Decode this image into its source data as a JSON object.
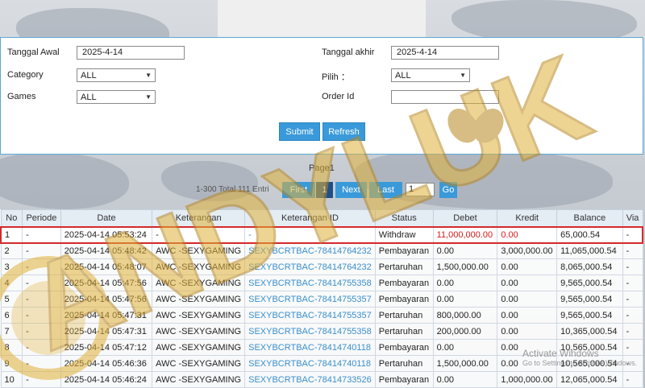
{
  "filters": {
    "tanggal_awal_label": "Tanggal Awal",
    "tanggal_awal_value": "2025-4-14",
    "tanggal_akhir_label": "Tanggal akhir",
    "tanggal_akhir_value": "2025-4-14",
    "category_label": "Category",
    "category_value": "ALL",
    "pilih_label": "Pilih ：",
    "pilih_value": "ALL",
    "games_label": "Games",
    "games_value": "ALL",
    "order_id_label": "Order Id",
    "order_id_value": ""
  },
  "buttons": {
    "submit": "Submit",
    "refresh": "Refresh"
  },
  "pager": {
    "title": "Page1",
    "info": "1-300 Total 111 Entri",
    "first": "First",
    "current": "1",
    "next": "Next",
    "last": "Last",
    "goto_value": "1",
    "go": "Go"
  },
  "table": {
    "headers": [
      "No",
      "Periode",
      "Date",
      "Keterangan",
      "Keterangan ID",
      "Status",
      "Debet",
      "Kredit",
      "Balance",
      "Via"
    ],
    "rows": [
      [
        "1",
        "-",
        "2025-04-14 05:53:24",
        "-",
        "-",
        "Withdraw",
        "11,000,000.00",
        "0.00",
        "65,000.54",
        "-"
      ],
      [
        "2",
        "-",
        "2025-04-14 05:48:42",
        "AWC -SEXYGAMING",
        "SEXYBCRTBAC-78414764232",
        "Pembayaran",
        "0.00",
        "3,000,000.00",
        "11,065,000.54",
        "-"
      ],
      [
        "3",
        "-",
        "2025-04-14 05:48:07",
        "AWC -SEXYGAMING",
        "SEXYBCRTBAC-78414764232",
        "Pertaruhan",
        "1,500,000.00",
        "0.00",
        "8,065,000.54",
        "-"
      ],
      [
        "4",
        "-",
        "2025-04-14 05:47:56",
        "AWC -SEXYGAMING",
        "SEXYBCRTBAC-78414755358",
        "Pembayaran",
        "0.00",
        "0.00",
        "9,565,000.54",
        "-"
      ],
      [
        "5",
        "-",
        "2025-04-14 05:47:56",
        "AWC -SEXYGAMING",
        "SEXYBCRTBAC-78414755357",
        "Pembayaran",
        "0.00",
        "0.00",
        "9,565,000.54",
        "-"
      ],
      [
        "6",
        "-",
        "2025-04-14 05:47:31",
        "AWC -SEXYGAMING",
        "SEXYBCRTBAC-78414755357",
        "Pertaruhan",
        "800,000.00",
        "0.00",
        "9,565,000.54",
        "-"
      ],
      [
        "7",
        "-",
        "2025-04-14 05:47:31",
        "AWC -SEXYGAMING",
        "SEXYBCRTBAC-78414755358",
        "Pertaruhan",
        "200,000.00",
        "0.00",
        "10,365,000.54",
        "-"
      ],
      [
        "8",
        "-",
        "2025-04-14 05:47:12",
        "AWC -SEXYGAMING",
        "SEXYBCRTBAC-78414740118",
        "Pembayaran",
        "0.00",
        "0.00",
        "10,565,000.54",
        "-"
      ],
      [
        "9",
        "-",
        "2025-04-14 05:46:36",
        "AWC -SEXYGAMING",
        "SEXYBCRTBAC-78414740118",
        "Pertaruhan",
        "1,500,000.00",
        "0.00",
        "10,565,000.54",
        "-"
      ],
      [
        "10",
        "-",
        "2025-04-14 05:46:24",
        "AWC -SEXYGAMING",
        "SEXYBCRTBAC-78414733526",
        "Pembayaran",
        "0.00",
        "1,000,000.00",
        "12,065,000.54",
        "-"
      ]
    ]
  },
  "watermark": {
    "text": "ANDYLUK",
    "activate_line1": "Activate Windows",
    "activate_line2": "Go to Settings to activate Windows.",
    "color": "#e0b23a"
  },
  "colors": {
    "accent": "#3a9ad9",
    "link": "#3a8fcc",
    "alert": "#d41a1a",
    "panel_border": "#5aa8d8"
  }
}
